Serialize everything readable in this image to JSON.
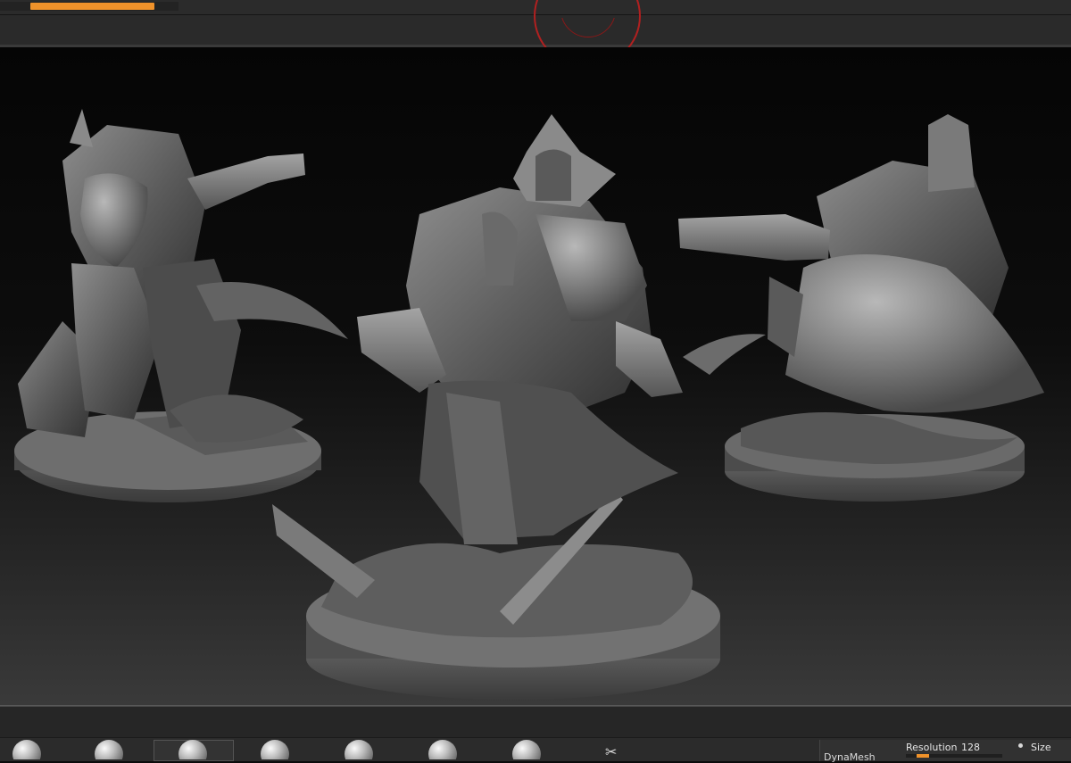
{
  "top_progress": {
    "value_percent": 0.87,
    "color": "#f0922a"
  },
  "viewport": {
    "background_top": "#050505",
    "background_bottom": "#3a3a3a",
    "gyro_color": "#b02020",
    "models": [
      "figure-left",
      "figure-center",
      "figure-right"
    ]
  },
  "brush_shelf": {
    "brushes": [
      "brush-1-icon",
      "brush-2-icon",
      "brush-3-icon",
      "brush-4-icon",
      "brush-5-icon",
      "brush-6-icon",
      "brush-7-icon",
      "brush-8-icon"
    ],
    "selected_index": 2,
    "scissor_glyph": "✂"
  },
  "dynamesh": {
    "label": "DynaMesh",
    "resolution_label": "Resolution",
    "resolution_value": "128",
    "resolution_fill_fraction": 0.15,
    "size_label": "Size",
    "accent": "#f0922a"
  }
}
